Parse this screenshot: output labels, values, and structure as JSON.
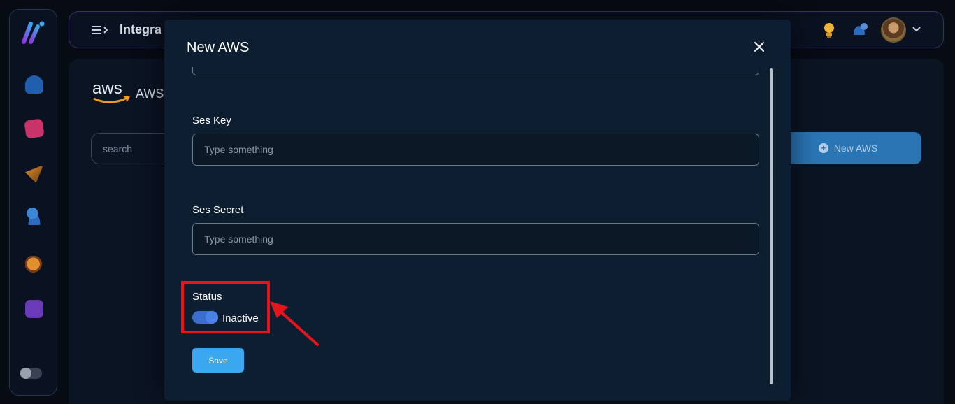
{
  "topbar": {
    "title": "Integra"
  },
  "page": {
    "heading": "AWS",
    "search_placeholder": "search",
    "new_button_label": "New AWS"
  },
  "modal": {
    "title": "New AWS",
    "fields": [
      {
        "label": "Ses Key",
        "placeholder": "Type something"
      },
      {
        "label": "Ses Secret",
        "placeholder": "Type something"
      }
    ],
    "status": {
      "label": "Status",
      "toggle_text": "Inactive"
    },
    "save_label": "Save"
  },
  "colors": {
    "accent": "#3aa7ef",
    "toggle": "#3a6fd0",
    "annotation": "#e8141c",
    "modal_bg": "#0d1e30"
  },
  "icons": {
    "close": "close-icon",
    "menu": "menu-icon",
    "bulb": "lightbulb-icon",
    "notifications": "bell-icon"
  }
}
